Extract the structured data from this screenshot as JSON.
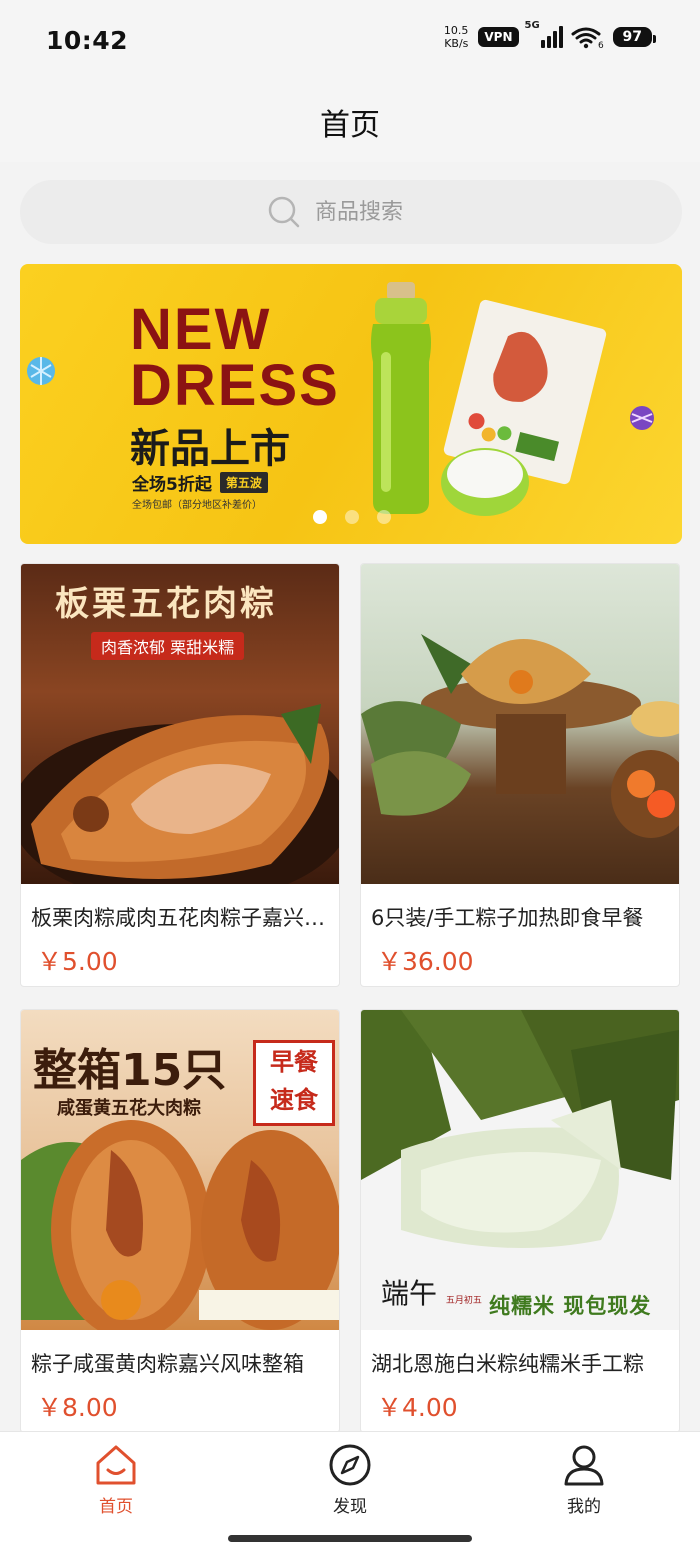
{
  "status_bar": {
    "time": "10:42",
    "net_speed_value": "10.5",
    "net_speed_unit": "KB/s",
    "vpn": "VPN",
    "network_type": "5G",
    "wifi_sub": "6",
    "battery": "97"
  },
  "header": {
    "title": "首页"
  },
  "search": {
    "placeholder": "商品搜索",
    "icon": "search-icon"
  },
  "banner": {
    "title_line1": "NEW",
    "title_line2": "DRESS",
    "subtitle": "新品上市",
    "promo": "全场5折起",
    "wave": "第五波",
    "note": "全场包邮（部分地区补差价）",
    "active_slide": 1,
    "slide_count": 3
  },
  "products": [
    {
      "name": "板栗肉粽咸肉五花肉粽子嘉兴风味",
      "price": "￥5.00",
      "image_headline": "板栗五花肉粽",
      "image_tag": "肉香浓郁 栗甜米糯"
    },
    {
      "name": "6只装/手工粽子加热即食早餐",
      "price": "￥36.00"
    },
    {
      "name": "粽子咸蛋黄肉粽嘉兴风味整箱",
      "price": "￥8.00",
      "image_headline": "整箱15只",
      "image_sub": "咸蛋黄五花大肉粽",
      "image_badge_1": "早餐",
      "image_badge_2": "速食"
    },
    {
      "name": "湖北恩施白米粽纯糯米手工粽",
      "price": "￥4.00",
      "image_brand": "端午",
      "image_brand_sub": "五月初五",
      "image_tag": "纯糯米 现包现发"
    }
  ],
  "tabbar": {
    "items": [
      {
        "label": "首页",
        "icon": "home-icon",
        "active": true
      },
      {
        "label": "发现",
        "icon": "compass-icon",
        "active": false
      },
      {
        "label": "我的",
        "icon": "user-icon",
        "active": false
      }
    ]
  },
  "colors": {
    "accent": "#e0502e",
    "banner_yellow": "#fbd020",
    "title_red": "#8b1313"
  }
}
